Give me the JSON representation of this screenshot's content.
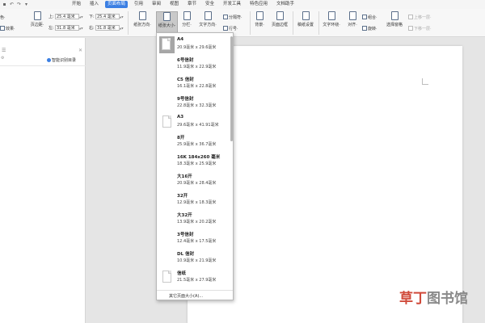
{
  "menubar": {
    "items": [
      {
        "label": "开始"
      },
      {
        "label": "插入"
      },
      {
        "label": "页面布局"
      },
      {
        "label": "引用"
      },
      {
        "label": "审阅"
      },
      {
        "label": "视图"
      },
      {
        "label": "章节"
      },
      {
        "label": "安全"
      },
      {
        "label": "开发工具"
      },
      {
        "label": "特色应用"
      },
      {
        "label": "文档助手"
      }
    ],
    "active_index": 2
  },
  "ribbon": {
    "color_label": "色·",
    "effect_label": "效果·",
    "margin_label": "页边距·",
    "margins": {
      "top": {
        "label": "上:",
        "value": "25.4 毫米"
      },
      "bottom": {
        "label": "下:",
        "value": "25.4 毫米"
      },
      "left": {
        "label": "左:",
        "value": "31.8 毫米"
      },
      "right": {
        "label": "右:",
        "value": "31.8 毫米"
      }
    },
    "orientation_label": "纸张方向·",
    "size_label": "纸张大小·",
    "columns_label": "分栏·",
    "text_direction_label": "文字方向·",
    "break_label": "分隔符·",
    "line_number_label": "行号·",
    "background_label": "背景·",
    "page_border_label": "页面边框",
    "page_setup_label": "稿纸设置",
    "text_wrap_label": "文字环绕·",
    "align_label": "对齐·",
    "group_label": "组合·",
    "rotate_label": "旋转·",
    "select_pane_label": "选择窗格",
    "bring_forward_label": "上移一层·",
    "send_backward_label": "下移一层·"
  },
  "leftpane": {
    "smart_toc": "智能识别目录"
  },
  "paper_sizes": [
    {
      "name": "A4",
      "size": "20.9毫米 x 29.6毫米"
    },
    {
      "name": "6号信封",
      "size": "11.9毫米 x 22.9毫米"
    },
    {
      "name": "C5 信封",
      "size": "16.1毫米 x 22.8毫米"
    },
    {
      "name": "9号信封",
      "size": "22.8毫米 x 32.3毫米"
    },
    {
      "name": "A3",
      "size": "29.6毫米 x 41.91毫米"
    },
    {
      "name": "8开",
      "size": "25.9毫米 x 36.7毫米"
    },
    {
      "name": "16K 184x260 毫米",
      "size": "18.3毫米 x 25.9毫米"
    },
    {
      "name": "大16开",
      "size": "20.9毫米 x 28.4毫米"
    },
    {
      "name": "32开",
      "size": "12.9毫米 x 18.3毫米"
    },
    {
      "name": "大32开",
      "size": "13.9毫米 x 20.2毫米"
    },
    {
      "name": "3号信封",
      "size": "12.4毫米 x 17.5毫米"
    },
    {
      "name": "DL 信封",
      "size": "10.9毫米 x 21.9毫米"
    },
    {
      "name": "信纸",
      "size": "21.5毫米 x 27.9毫米"
    }
  ],
  "dropdown_footer": "其它页面大小(A)...",
  "watermark": {
    "part1": "草丁",
    "part2": "图书馆"
  },
  "colors": {
    "accent": "#3b7fe3",
    "selected_gray": "#a6a6a6"
  }
}
